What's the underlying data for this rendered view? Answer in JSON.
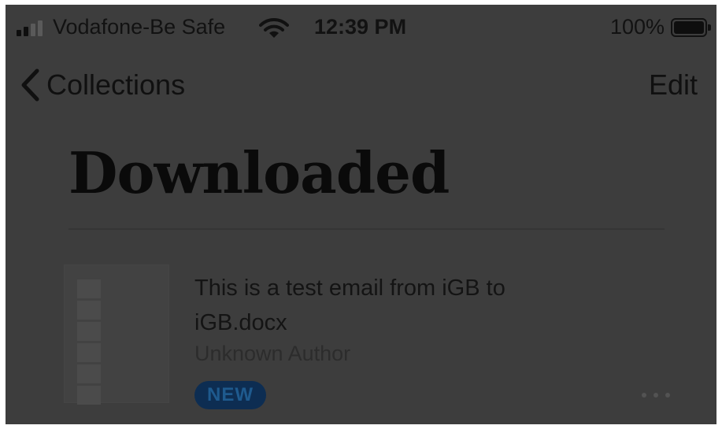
{
  "status_bar": {
    "carrier": "Vodafone-Be Safe",
    "time": "12:39 PM",
    "battery": "100%",
    "signal_bars_active": 2,
    "signal_bars_total": 4,
    "battery_level": 1.0,
    "icons": [
      "signal-icon",
      "wifi-icon",
      "battery-icon"
    ]
  },
  "nav": {
    "back_label": "Collections",
    "edit_label": "Edit",
    "icons": [
      "chevron-left-icon"
    ]
  },
  "page": {
    "title": "Downloaded"
  },
  "items": [
    {
      "title": "This is a test email from iGB to iGB.docx",
      "author": "Unknown Author",
      "badge": "NEW",
      "icons": [
        "document-thumbnail-icon",
        "more-options-icon"
      ]
    }
  ],
  "colors": {
    "screen_overlay": "#3d3d3d",
    "badge_background": "#0d2d52",
    "badge_text": "#1e5a8e",
    "text": "#101010"
  }
}
